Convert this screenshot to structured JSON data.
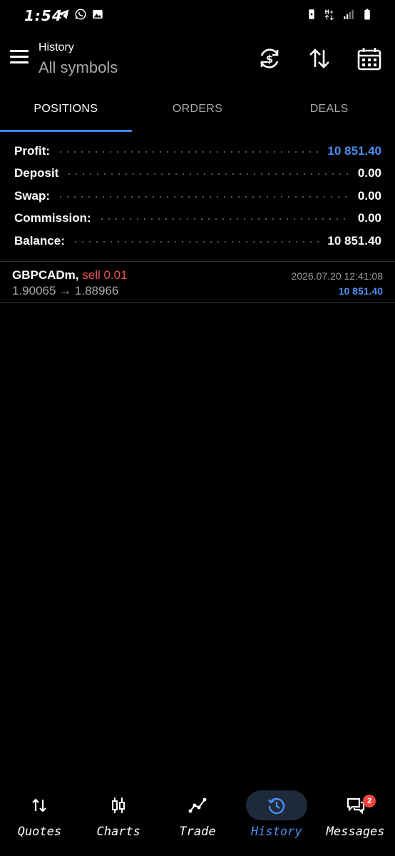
{
  "status_bar": {
    "time": "1:54",
    "left_icons": [
      "telegram-icon",
      "whatsapp-icon",
      "gallery-icon"
    ],
    "right_icons": [
      "battery-saver-icon",
      "network-hplus-icon",
      "signal-icon",
      "battery-icon"
    ]
  },
  "header": {
    "title": "History",
    "subtitle": "All symbols",
    "icons": [
      "currency-refresh-icon",
      "sort-icon",
      "calendar-icon"
    ]
  },
  "tabs": [
    {
      "label": "POSITIONS",
      "active": true
    },
    {
      "label": "ORDERS",
      "active": false
    },
    {
      "label": "DEALS",
      "active": false
    }
  ],
  "summary": {
    "profit": {
      "label": "Profit:",
      "value": "10 851.40"
    },
    "deposit": {
      "label": "Deposit",
      "value": "0.00"
    },
    "swap": {
      "label": "Swap:",
      "value": "0.00"
    },
    "commission": {
      "label": "Commission:",
      "value": "0.00"
    },
    "balance": {
      "label": "Balance:",
      "value": "10 851.40"
    }
  },
  "positions": [
    {
      "symbol": "GBPCADm,",
      "side": "sell 0.01",
      "prices": "1.90065 → 1.88966",
      "time": "2026.07.20 12:41:08",
      "profit": "10 851.40"
    }
  ],
  "bottom_nav": [
    {
      "label": "Quotes",
      "icon": "quotes-icon",
      "active": false
    },
    {
      "label": "Charts",
      "icon": "charts-icon",
      "active": false
    },
    {
      "label": "Trade",
      "icon": "trade-icon",
      "active": false
    },
    {
      "label": "History",
      "icon": "history-icon",
      "active": true
    },
    {
      "label": "Messages",
      "icon": "messages-icon",
      "active": false,
      "badge": "2"
    }
  ],
  "colors": {
    "background": "#000000",
    "accent_blue": "#4a8ff2",
    "sell_red": "#ef5350",
    "muted_text": "#a9a9ad"
  }
}
